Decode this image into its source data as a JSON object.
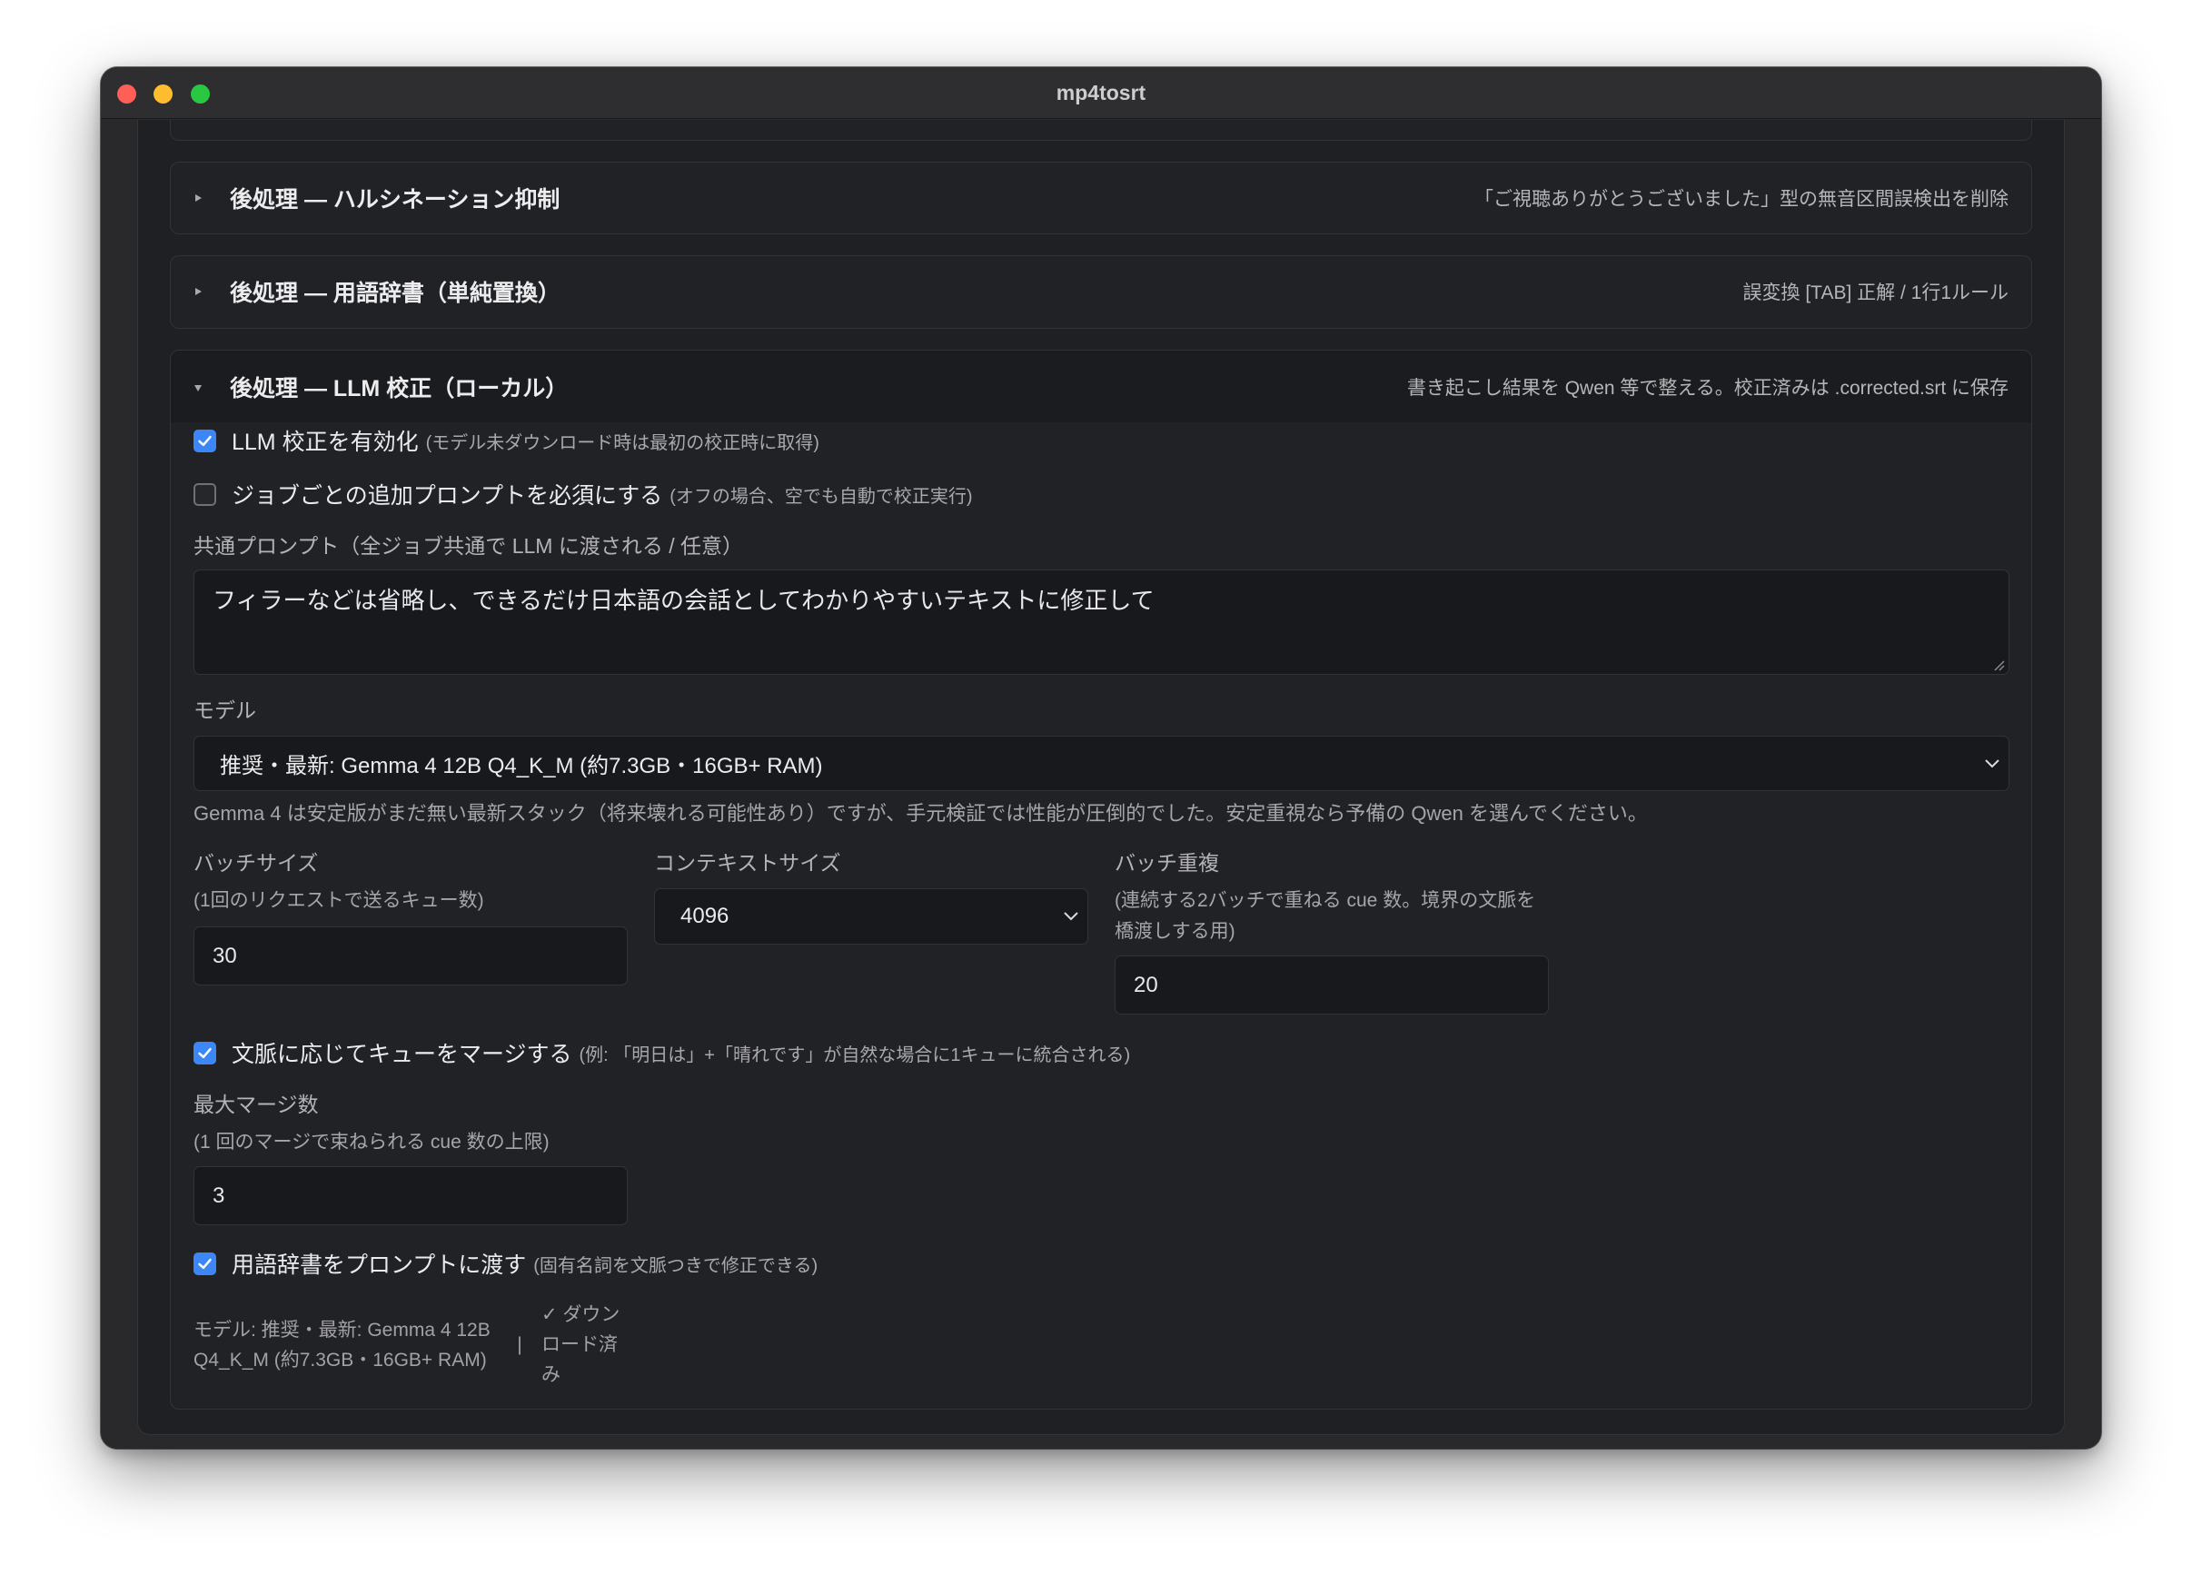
{
  "window": {
    "title": "mp4tosrt"
  },
  "colors": {
    "accent": "#3d86f5",
    "close": "#ff5f57",
    "minimize": "#febc2e",
    "zoom": "#28c840"
  },
  "sections": [
    {
      "title": "後処理 — ハルシネーション抑制",
      "description": "「ご視聴ありがとうございました」型の無音区間誤検出を削除",
      "expanded": false
    },
    {
      "title": "後処理 — 用語辞書（単純置換）",
      "description": "誤変換 [TAB] 正解 / 1行1ルール",
      "expanded": false
    },
    {
      "title": "後処理 — LLM 校正（ローカル）",
      "description": "書き起こし結果を Qwen 等で整える。校正済みは .corrected.srt に保存",
      "expanded": true
    }
  ],
  "llm": {
    "enable": {
      "label": "LLM 校正を有効化",
      "note": "(モデル未ダウンロード時は最初の校正時に取得)",
      "checked": true
    },
    "require_prompt": {
      "label": "ジョブごとの追加プロンプトを必須にする",
      "note": "(オフの場合、空でも自動で校正実行)",
      "checked": false
    },
    "common_prompt": {
      "label": "共通プロンプト（全ジョブ共通で LLM に渡される / 任意）",
      "value": "フィラーなどは省略し、できるだけ日本語の会話としてわかりやすいテキストに修正して"
    },
    "model": {
      "label": "モデル",
      "value": "推奨・最新: Gemma 4 12B Q4_K_M (約7.3GB・16GB+ RAM)",
      "help": "Gemma 4 は安定版がまだ無い最新スタック（将来壊れる可能性あり）ですが、手元検証では性能が圧倒的でした。安定重視なら予備の Qwen を選んでください。"
    },
    "batch_size": {
      "label": "バッチサイズ",
      "note": "(1回のリクエストで送るキュー数)",
      "value": "30"
    },
    "context_size": {
      "label": "コンテキストサイズ",
      "value": "4096"
    },
    "batch_overlap": {
      "label": "バッチ重複",
      "note": "(連続する2バッチで重ねる cue 数。境界の文脈を橋渡しする用)",
      "value": "20"
    },
    "merge": {
      "label": "文脈に応じてキューをマージする",
      "note": "(例: 「明日は」+「晴れです」が自然な場合に1キューに統合される)",
      "checked": true
    },
    "max_merge": {
      "label": "最大マージ数",
      "note": "(1 回のマージで束ねられる cue 数の上限)",
      "value": "3"
    },
    "pass_dictionary": {
      "label": "用語辞書をプロンプトに渡す",
      "note": "(固有名詞を文脈つきで修正できる)",
      "checked": true
    },
    "status": {
      "model_text": "モデル: 推奨・最新: Gemma 4 12B Q4_K_M (約7.3GB・16GB+ RAM)",
      "separator": "|",
      "download_status": "✓ ダウンロード済み"
    }
  }
}
